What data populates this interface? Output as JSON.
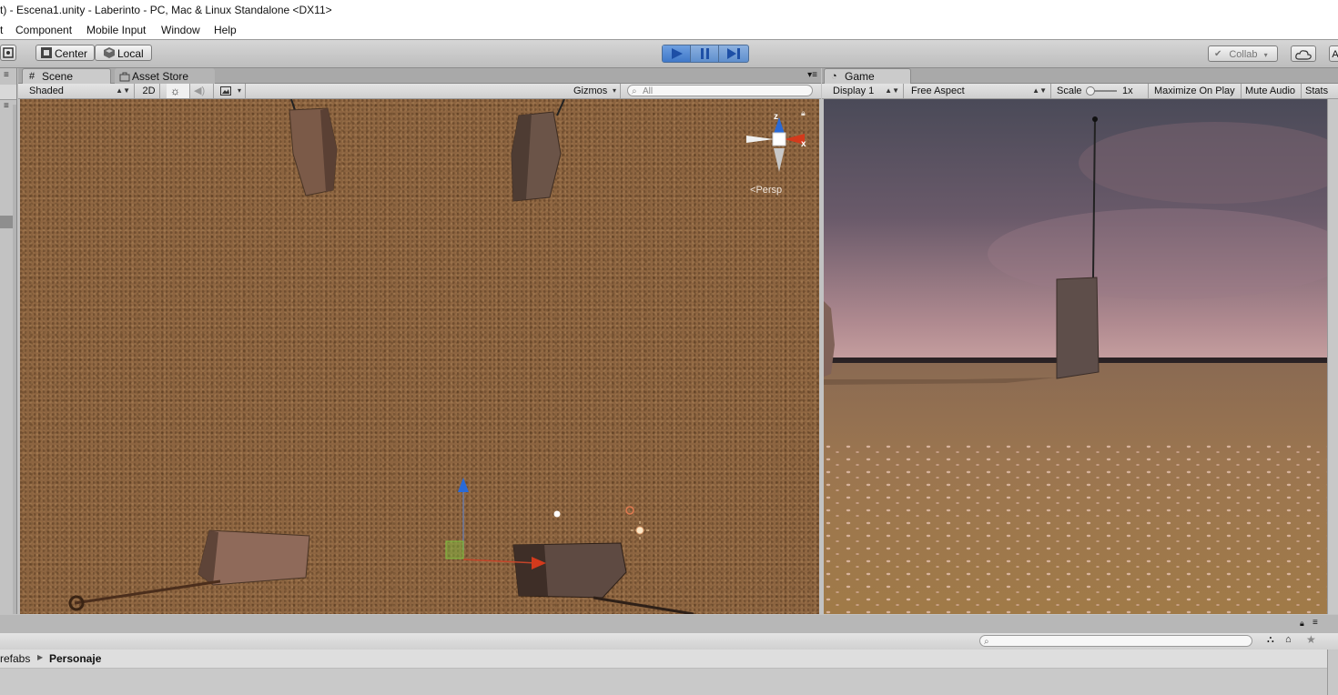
{
  "window": {
    "title": "t) - Escena1.unity - Laberinto - PC, Mac & Linux Standalone <DX11>"
  },
  "menu": [
    "t",
    "Component",
    "Mobile Input",
    "Window",
    "Help"
  ],
  "toolbar": {
    "pivot_label": "Center",
    "space_label": "Local",
    "collab_label": "Collab",
    "account_label": "A"
  },
  "scene_panel": {
    "tabs": [
      "Scene",
      "Asset Store"
    ],
    "shading_mode": "Shaded",
    "mode_2d_label": "2D",
    "gizmos_label": "Gizmos",
    "search_placeholder": "All",
    "projection_label": "Persp",
    "axis_labels": {
      "z": "z",
      "x": "x"
    }
  },
  "game_panel": {
    "tab": "Game",
    "display": "Display 1",
    "aspect": "Free Aspect",
    "scale_label": "Scale",
    "scale_value": "1x",
    "maximize_label": "Maximize On Play",
    "mute_label": "Mute Audio",
    "stats_label": "Stats"
  },
  "project_panel": {
    "breadcrumb": [
      "refabs",
      "Personaje"
    ],
    "search_placeholder": ""
  },
  "colors": {
    "play_blue": "#5f8fce",
    "ground_brown": "#8c6440",
    "axis_red": "#d33a1c",
    "axis_blue": "#2a6ad6",
    "axis_green": "#7fbf3f"
  },
  "icons": [
    "unity-logo-icon",
    "play-icon",
    "pause-icon",
    "step-icon",
    "cloud-icon",
    "sun-icon",
    "speaker-icon",
    "image-icon",
    "search-icon",
    "lock-icon",
    "menu-icon",
    "light-icon",
    "camera-icon",
    "filter-icon",
    "label-icon",
    "star-icon"
  ]
}
